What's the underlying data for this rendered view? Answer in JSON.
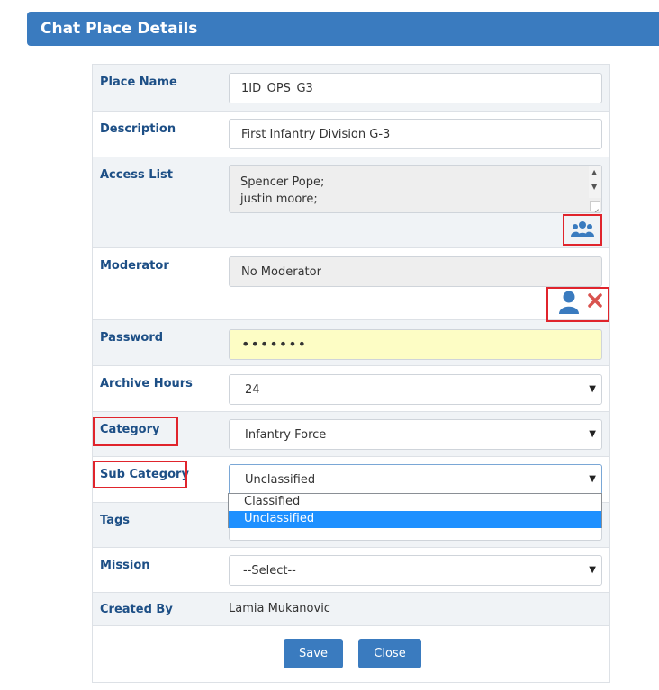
{
  "header": {
    "title": "Chat Place Details"
  },
  "form": {
    "place_name": {
      "label": "Place Name",
      "value": "1ID_OPS_G3"
    },
    "description": {
      "label": "Description",
      "value": "First Infantry Division G-3"
    },
    "access_list": {
      "label": "Access List",
      "lines": [
        "Spencer Pope;",
        "justin moore;"
      ]
    },
    "moderator": {
      "label": "Moderator",
      "value": "No Moderator"
    },
    "password": {
      "label": "Password",
      "value": "•••••••"
    },
    "archive_hours": {
      "label": "Archive Hours",
      "value": "24"
    },
    "category": {
      "label": "Category",
      "value": "Infantry Force"
    },
    "sub_category": {
      "label": "Sub Category",
      "value": "Unclassified",
      "options": [
        "Classified",
        "Unclassified"
      ]
    },
    "tags": {
      "label": "Tags"
    },
    "mission": {
      "label": "Mission",
      "value": "--Select--"
    },
    "created_by": {
      "label": "Created By",
      "value": "Lamia Mukanovic"
    }
  },
  "buttons": {
    "save": "Save",
    "close": "Close"
  },
  "colors": {
    "primary": "#3a7bbf",
    "label": "#1d4f86",
    "highlight": "#e0242c",
    "selected_option": "#1e90ff",
    "password_bg": "#fdfdc5"
  },
  "icons": {
    "group": "group-users-icon",
    "user": "user-icon",
    "remove": "close-x-icon"
  }
}
